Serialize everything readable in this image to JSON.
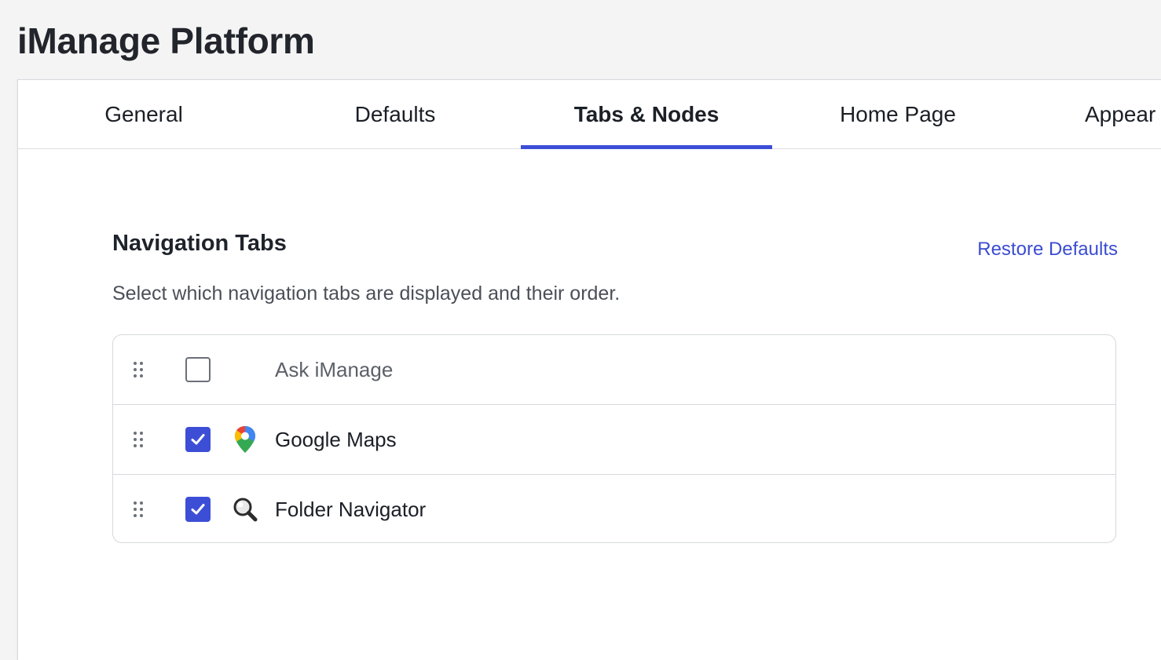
{
  "app": {
    "title": "iManage Platform"
  },
  "tabs": [
    {
      "label": "General",
      "active": false
    },
    {
      "label": "Defaults",
      "active": false
    },
    {
      "label": "Tabs & Nodes",
      "active": true
    },
    {
      "label": "Home Page",
      "active": false
    },
    {
      "label": "Appear",
      "active": false
    }
  ],
  "section": {
    "title": "Navigation Tabs",
    "description": "Select which navigation tabs are displayed and their order.",
    "restore_label": "Restore Defaults"
  },
  "nav_tabs": [
    {
      "label": "Ask iManage",
      "checked": false,
      "icon": "none"
    },
    {
      "label": "Google Maps",
      "checked": true,
      "icon": "google-maps-pin-icon"
    },
    {
      "label": "Folder Navigator",
      "checked": true,
      "icon": "magnifier-icon"
    }
  ],
  "colors": {
    "accent": "#3d4ed6",
    "link": "#3b4cd1",
    "background": "#f4f4f4",
    "panel": "#ffffff"
  }
}
